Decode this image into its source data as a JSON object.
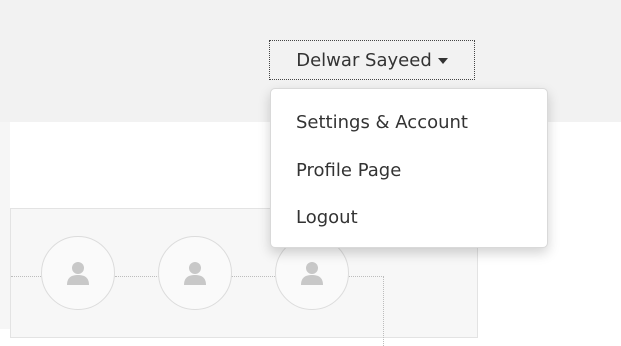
{
  "header": {
    "user_menu": {
      "username": "Delwar Sayeed",
      "caret_icon": "caret-down-icon"
    }
  },
  "dropdown": {
    "items": [
      {
        "label": "Settings & Account"
      },
      {
        "label": "Profile Page"
      },
      {
        "label": "Logout"
      }
    ]
  },
  "content": {
    "avatar_icon": "user-avatar-icon"
  },
  "colors": {
    "header_bg": "#f2f2f2",
    "card_bg": "#f7f7f7",
    "text": "#333333",
    "avatar_silhouette": "#c8c8c8"
  }
}
